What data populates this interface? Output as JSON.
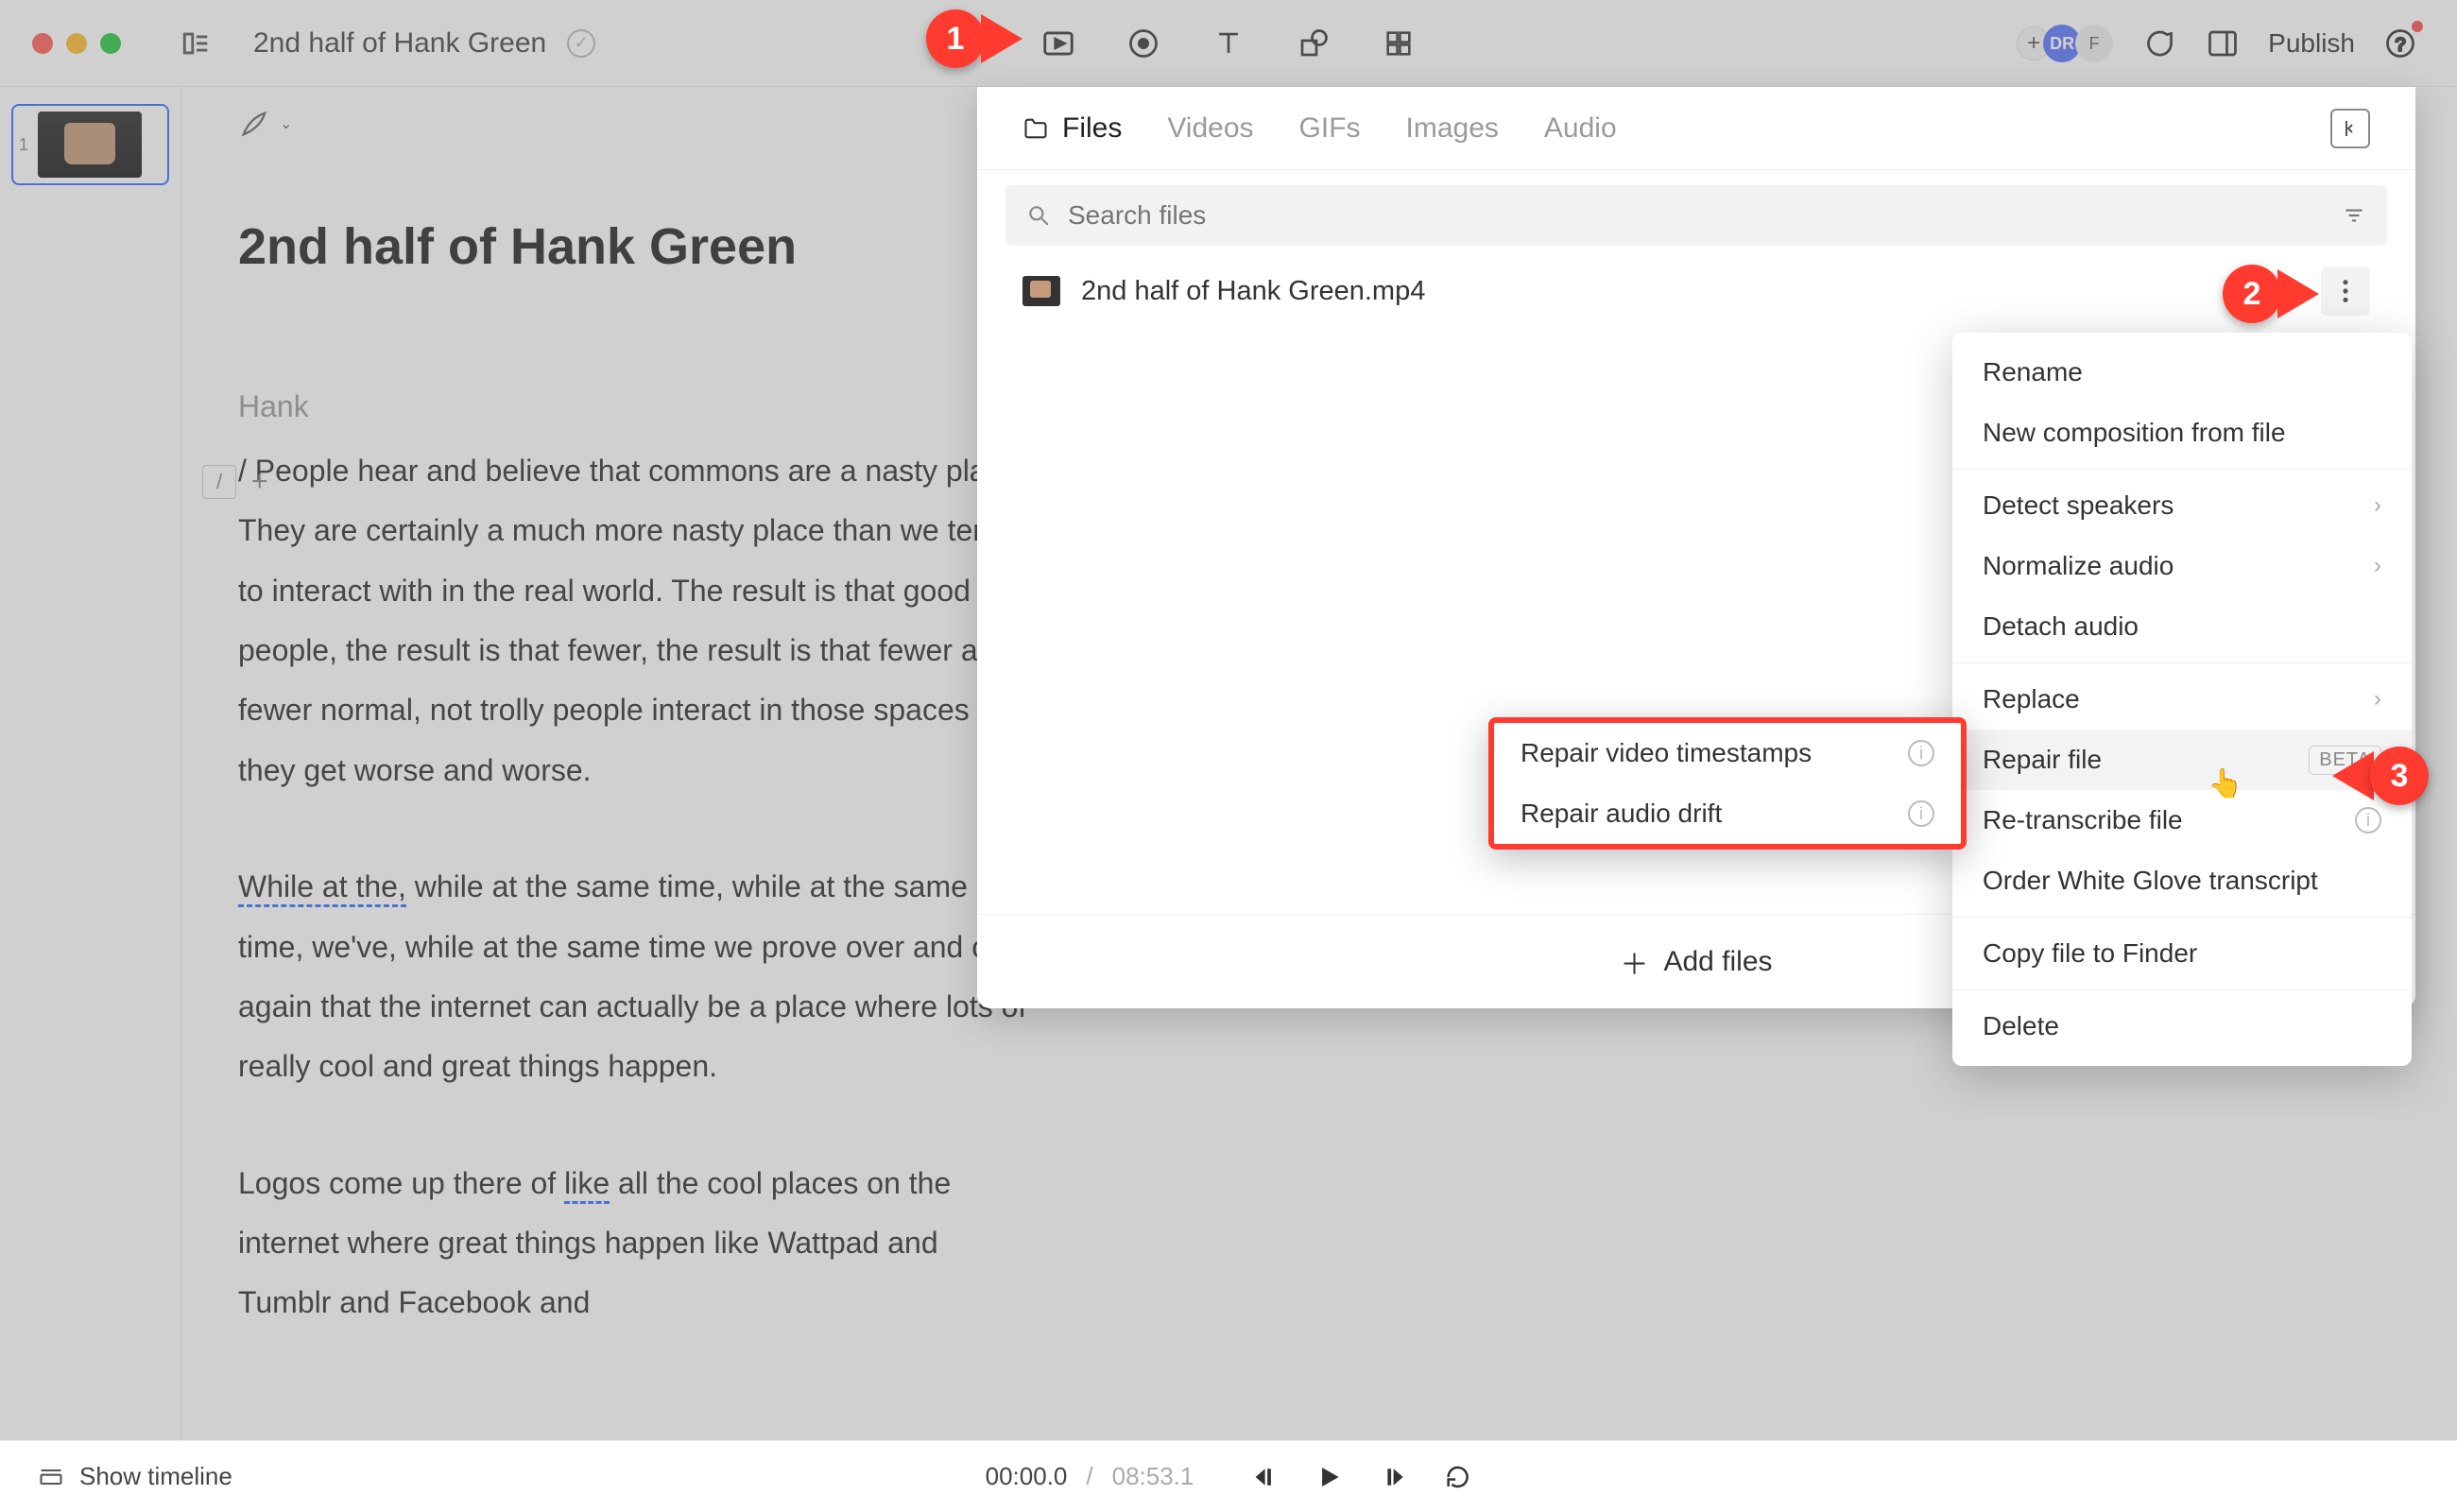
{
  "topbar": {
    "doc_title": "2nd half of Hank Green",
    "publish": "Publish",
    "avatars": {
      "a1": "DR",
      "a2": "F"
    }
  },
  "scenes": {
    "first_num": "1"
  },
  "script": {
    "title": "2nd half of Hank Green",
    "speaker": "Hank",
    "p1_lead": "/ ",
    "p1": "People hear and believe that commons are a nasty place. They are certainly a much more nasty place than we tend to interact with in the real world. The result is that good people, the result is that fewer, the result is that fewer and fewer normal, not trolly people interact in those spaces and they get worse and worse.",
    "p2_u": "While at the,",
    "p2_rest": " while at the same time, while at the same time, we've, while at the same time we prove over and over again that the internet can actually be a place where lots of really cool and great things happen.",
    "p3_a": "Logos come up there of ",
    "p3_u": "like",
    "p3_b": " all the cool places on the internet where great things happen like Wattpad and Tumblr and Facebook and"
  },
  "panel": {
    "tabs": {
      "files": "Files",
      "videos": "Videos",
      "gifs": "GIFs",
      "images": "Images",
      "audio": "Audio"
    },
    "search_placeholder": "Search files",
    "file_name": "2nd half of Hank Green.mp4",
    "add_files": "Add files"
  },
  "ctx": {
    "rename": "Rename",
    "new_comp": "New composition from file",
    "detect_speakers": "Detect speakers",
    "normalize": "Normalize audio",
    "detach": "Detach audio",
    "replace": "Replace",
    "repair": "Repair file",
    "beta": "BETA",
    "retranscribe": "Re-transcribe file",
    "white_glove": "Order White Glove transcript",
    "copy_finder": "Copy file to Finder",
    "delete": "Delete"
  },
  "submenu": {
    "video_ts": "Repair video timestamps",
    "audio_drift": "Repair audio drift"
  },
  "markers": {
    "m1": "1",
    "m2": "2",
    "m3": "3"
  },
  "playbar": {
    "show_timeline": "Show timeline",
    "current": "00:00.0",
    "sep": "/",
    "total": "08:53.1"
  }
}
